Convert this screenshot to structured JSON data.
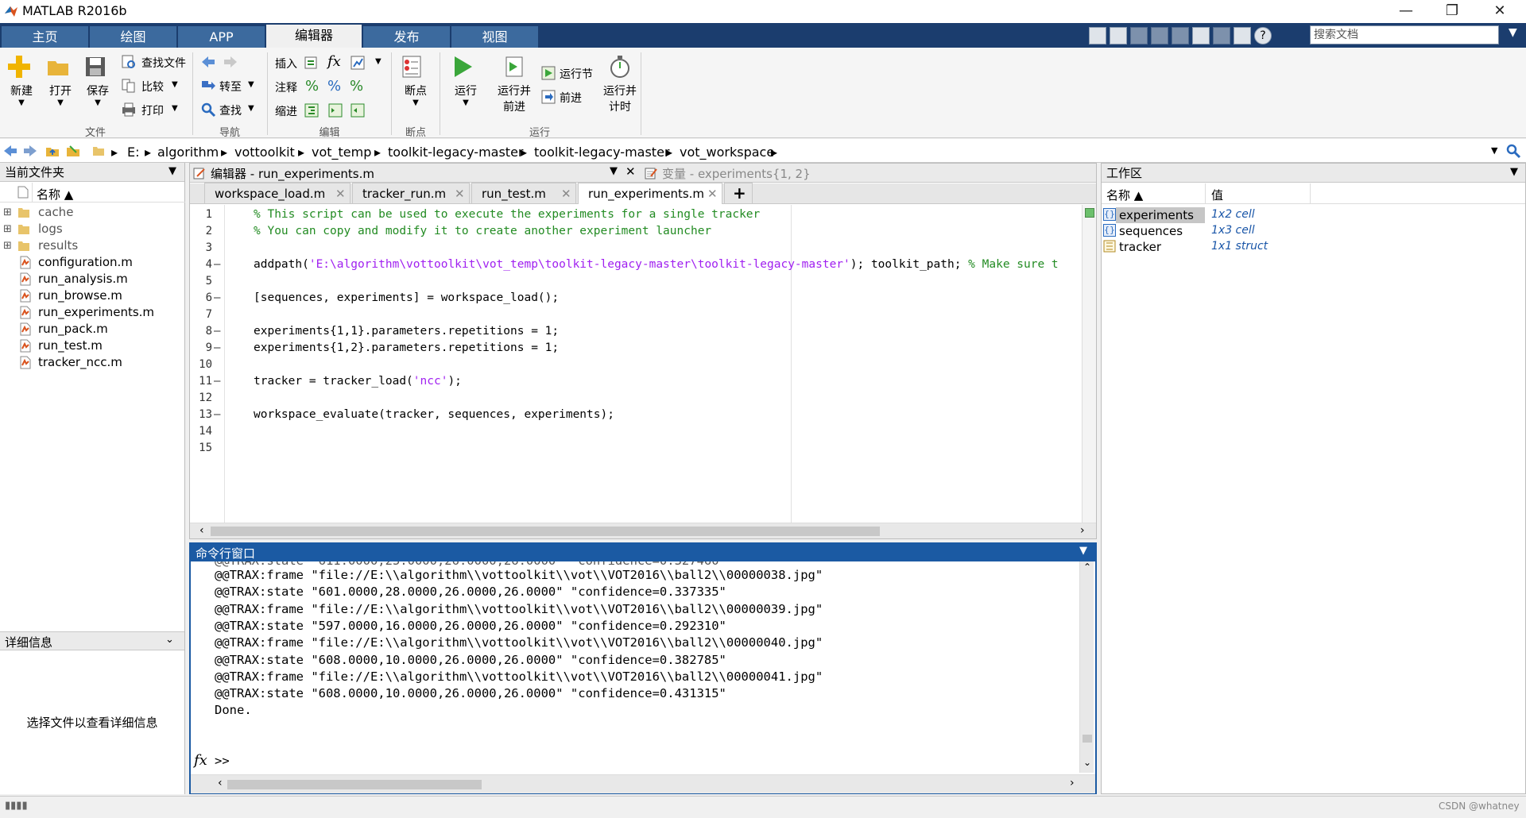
{
  "window": {
    "title": "MATLAB R2016b"
  },
  "ribbon_tabs": [
    "主页",
    "绘图",
    "APP",
    "编辑器",
    "发布",
    "视图"
  ],
  "search": {
    "placeholder": "搜索文档"
  },
  "toolbar": {
    "file": {
      "new": "新建",
      "open": "打开",
      "save": "保存",
      "find_files": "查找文件",
      "compare": "比较",
      "print": "打印",
      "group": "文件"
    },
    "navigate": {
      "goto": "转至",
      "find": "查找",
      "group": "导航"
    },
    "edit": {
      "insert": "插入",
      "fx": "fx",
      "comment": "注释",
      "indent": "缩进",
      "group": "编辑"
    },
    "breakpoints": {
      "label": "断点",
      "group": "断点"
    },
    "run": {
      "run": "运行",
      "run_advance_1": "运行并",
      "run_advance_2": "前进",
      "run_section": "运行节",
      "advance": "前进",
      "run_time_1": "运行并",
      "run_time_2": "计时",
      "group": "运行"
    }
  },
  "address": {
    "crumbs": [
      "E:",
      "algorithm",
      "vottoolkit",
      "vot_temp",
      "toolkit-legacy-master",
      "toolkit-legacy-master",
      "vot_workspace"
    ]
  },
  "current_folder": {
    "title": "当前文件夹",
    "col_name": "名称 ▲",
    "folders": [
      "cache",
      "logs",
      "results"
    ],
    "files": [
      "configuration.m",
      "run_analysis.m",
      "run_browse.m",
      "run_experiments.m",
      "run_pack.m",
      "run_test.m",
      "tracker_ncc.m"
    ]
  },
  "details": {
    "title": "详细信息",
    "message": "选择文件以查看详细信息"
  },
  "editor": {
    "title": "编辑器 - run_experiments.m",
    "var_title": "变量 - experiments{1, 2}",
    "tabs": [
      "workspace_load.m",
      "tracker_run.m",
      "run_test.m",
      "run_experiments.m"
    ],
    "add_tab": "+",
    "lines": [
      {
        "n": "1",
        "dash": "",
        "parts": [
          {
            "c": "cm",
            "t": "% This script can be used to execute the experiments for a single tracker"
          }
        ]
      },
      {
        "n": "2",
        "dash": "",
        "parts": [
          {
            "c": "cm",
            "t": "% You can copy and modify it to create another experiment launcher"
          }
        ]
      },
      {
        "n": "3",
        "dash": "",
        "parts": []
      },
      {
        "n": "4",
        "dash": "—",
        "parts": [
          {
            "c": "",
            "t": "addpath("
          },
          {
            "c": "str",
            "t": "'E:\\algorithm\\vottoolkit\\vot_temp\\toolkit-legacy-master\\toolkit-legacy-master'"
          },
          {
            "c": "",
            "t": "); toolkit_path; "
          },
          {
            "c": "cm",
            "t": "% Make sure t"
          }
        ]
      },
      {
        "n": "5",
        "dash": "",
        "parts": []
      },
      {
        "n": "6",
        "dash": "—",
        "parts": [
          {
            "c": "",
            "t": "[sequences, experiments] = workspace_load();"
          }
        ]
      },
      {
        "n": "7",
        "dash": "",
        "parts": []
      },
      {
        "n": "8",
        "dash": "—",
        "parts": [
          {
            "c": "",
            "t": "experiments{1,1}.parameters.repetitions = 1;"
          }
        ]
      },
      {
        "n": "9",
        "dash": "—",
        "parts": [
          {
            "c": "",
            "t": "experiments{1,2}.parameters.repetitions = 1;"
          }
        ]
      },
      {
        "n": "10",
        "dash": "",
        "parts": []
      },
      {
        "n": "11",
        "dash": "—",
        "parts": [
          {
            "c": "",
            "t": "tracker = tracker_load("
          },
          {
            "c": "str",
            "t": "'ncc'"
          },
          {
            "c": "",
            "t": ");"
          }
        ]
      },
      {
        "n": "12",
        "dash": "",
        "parts": []
      },
      {
        "n": "13",
        "dash": "—",
        "parts": [
          {
            "c": "",
            "t": "workspace_evaluate(tracker, sequences, experiments);"
          }
        ]
      },
      {
        "n": "14",
        "dash": "",
        "parts": []
      },
      {
        "n": "15",
        "dash": "",
        "parts": []
      }
    ]
  },
  "command_window": {
    "title": "命令行窗口",
    "lines": [
      "@@TRAX:frame \"file://E:\\\\algorithm\\\\vottoolkit\\\\vot\\\\VOT2016\\\\ball2\\\\00000038.jpg\"",
      "@@TRAX:state \"601.0000,28.0000,26.0000,26.0000\" \"confidence=0.337335\"",
      "@@TRAX:frame \"file://E:\\\\algorithm\\\\vottoolkit\\\\vot\\\\VOT2016\\\\ball2\\\\00000039.jpg\"",
      "@@TRAX:state \"597.0000,16.0000,26.0000,26.0000\" \"confidence=0.292310\"",
      "@@TRAX:frame \"file://E:\\\\algorithm\\\\vottoolkit\\\\vot\\\\VOT2016\\\\ball2\\\\00000040.jpg\"",
      "@@TRAX:state \"608.0000,10.0000,26.0000,26.0000\" \"confidence=0.382785\"",
      "@@TRAX:frame \"file://E:\\\\algorithm\\\\vottoolkit\\\\vot\\\\VOT2016\\\\ball2\\\\00000041.jpg\"",
      "@@TRAX:state \"608.0000,10.0000,26.0000,26.0000\" \"confidence=0.431315\"",
      "Done."
    ],
    "prompt": ">>",
    "fx": "fx"
  },
  "workspace": {
    "title": "工作区",
    "col_name": "名称 ▲",
    "col_value": "值",
    "vars": [
      {
        "name": "experiments",
        "value": "1x2 cell"
      },
      {
        "name": "sequences",
        "value": "1x3 cell"
      },
      {
        "name": "tracker",
        "value": "1x1 struct"
      }
    ]
  },
  "status": {
    "watermark": "CSDN @whatney"
  }
}
